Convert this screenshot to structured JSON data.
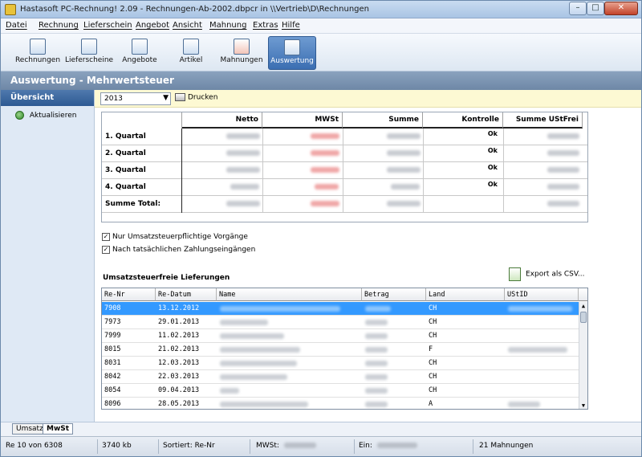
{
  "window": {
    "title": "Hastasoft PC-Rechnung! 2.09 - Rechnungen-Ab-2002.dbpcr in \\\\Vertrieb\\D\\Rechnungen"
  },
  "menu": [
    "Datei",
    "Rechnung",
    "Lieferschein",
    "Angebot",
    "Ansicht",
    "Mahnung",
    "Extras",
    "Hilfe"
  ],
  "toolbar": [
    "Rechnungen",
    "Lieferscheine",
    "Angebote",
    "Artikel",
    "Mahnungen",
    "Auswertung"
  ],
  "header": {
    "title": "Auswertung - Mehrwertsteuer"
  },
  "sidebar": {
    "title": "Übersicht",
    "refresh": "Aktualisieren"
  },
  "filter": {
    "year": "2013",
    "print": "Drucken"
  },
  "summary": {
    "columns": [
      "Netto",
      "MWSt",
      "Summe",
      "Kontrolle",
      "Summe UStFrei"
    ],
    "rows": [
      {
        "label": "1. Quartal",
        "check": "Ok"
      },
      {
        "label": "2. Quartal",
        "check": "Ok"
      },
      {
        "label": "3. Quartal",
        "check": "Ok"
      },
      {
        "label": "4. Quartal",
        "check": "Ok"
      },
      {
        "label": "Summe Total:",
        "check": ""
      }
    ]
  },
  "options": {
    "taxable_only": "Nur Umsatzsteuerpflichtige Vorgänge",
    "by_payment": "Nach tatsächlichen Zahlungseingängen"
  },
  "exempt": {
    "title": "Umsatzsteuerfreie Lieferungen",
    "export": "Export als CSV...",
    "columns": [
      "Re-Nr",
      "Re-Datum",
      "Name",
      "Betrag",
      "Land",
      "UStID"
    ],
    "rows": [
      {
        "nr": "7908",
        "date": "13.12.2012",
        "land": "CH"
      },
      {
        "nr": "7973",
        "date": "29.01.2013",
        "land": "CH"
      },
      {
        "nr": "7999",
        "date": "11.02.2013",
        "land": "CH"
      },
      {
        "nr": "8015",
        "date": "21.02.2013",
        "land": "F"
      },
      {
        "nr": "8031",
        "date": "12.03.2013",
        "land": "CH"
      },
      {
        "nr": "8042",
        "date": "22.03.2013",
        "land": "CH"
      },
      {
        "nr": "8054",
        "date": "09.04.2013",
        "land": "CH"
      },
      {
        "nr": "8096",
        "date": "28.05.2013",
        "land": "A"
      }
    ]
  },
  "tabs": [
    "Umsatz",
    "MwSt"
  ],
  "status": {
    "record": "Re 10 von 6308",
    "size": "3740 kb",
    "sort": "Sortiert: Re-Nr",
    "vat": "MWSt:",
    "income": "Ein:",
    "reminders": "21 Mahnungen"
  }
}
